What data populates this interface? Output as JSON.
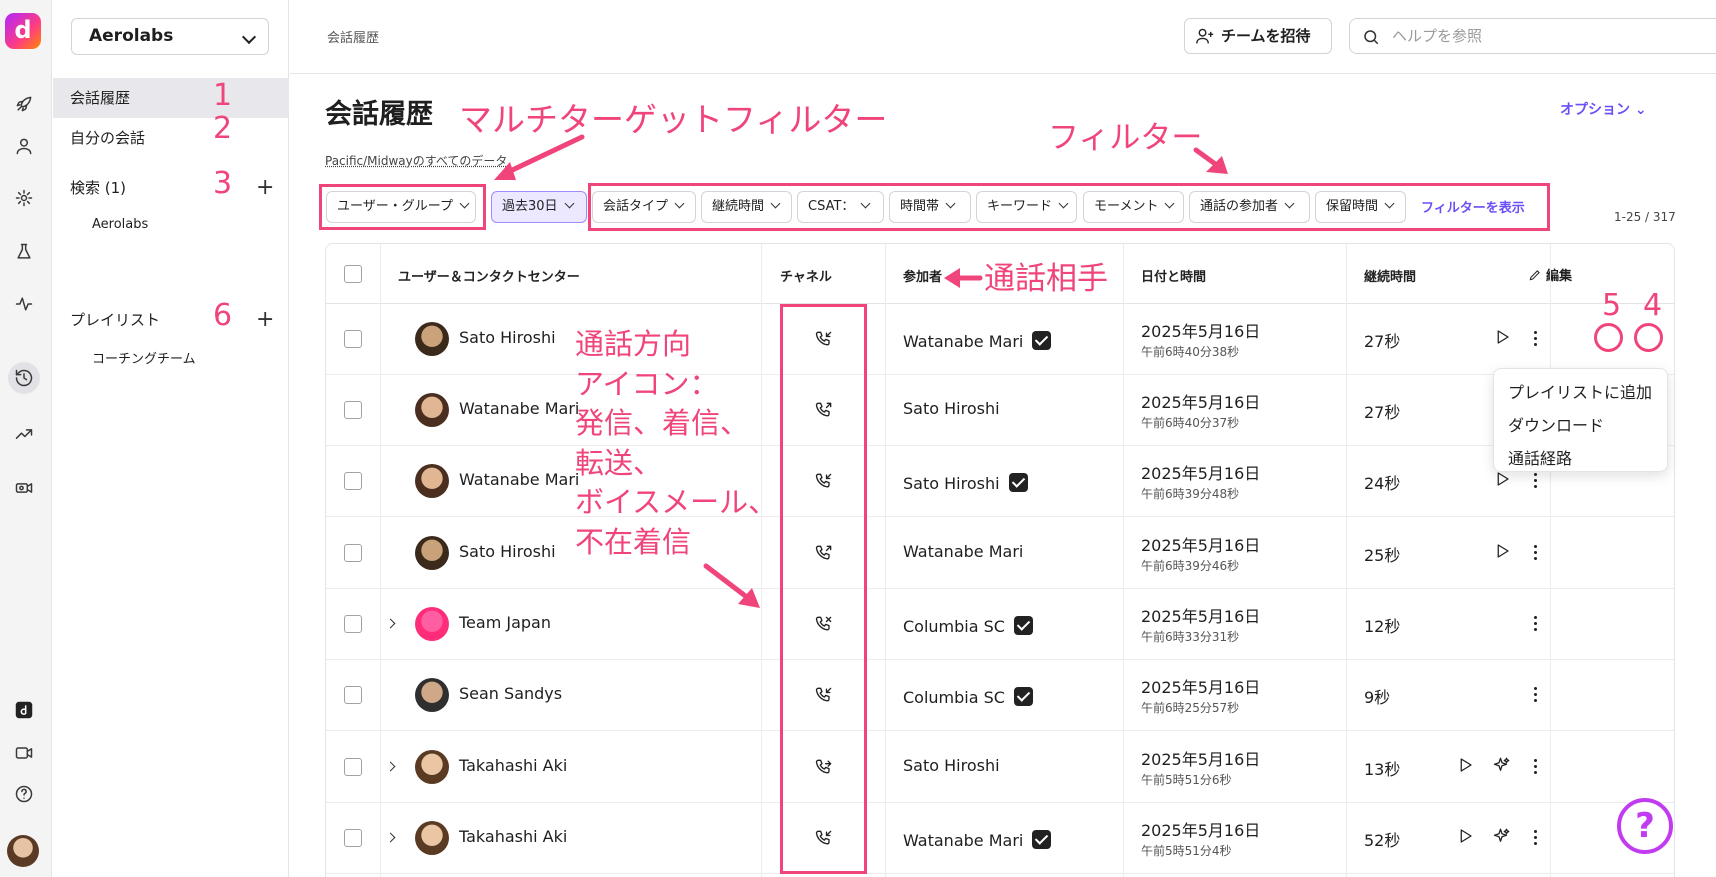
{
  "app": {
    "logo_letter": "d"
  },
  "rail": {
    "icons": [
      "rocket-icon",
      "person-icon",
      "gear-icon",
      "flask-icon",
      "pulse-icon",
      "history-icon",
      "trend-icon",
      "video-gear-icon",
      "dialpad-logo-icon",
      "camera-icon",
      "help-icon"
    ]
  },
  "sidebar": {
    "org": "Aerolabs",
    "items": [
      {
        "label": "会話履歴",
        "num": "1"
      },
      {
        "label": "自分の会話",
        "num": "2"
      },
      {
        "label": "検索 (1)",
        "num": "3"
      },
      {
        "label": "プレイリスト",
        "num": "6"
      }
    ],
    "search_sub": "Aerolabs",
    "playlist_sub": "コーチングチーム",
    "plus": "+"
  },
  "topbar": {
    "breadcrumb": "会話履歴",
    "invite_label": "チームを招待",
    "search_placeholder": "ヘルプを参照"
  },
  "main": {
    "title": "会話履歴",
    "options_label": "オプション ⌄",
    "timezone_note": "Pacific/Midwayのすべてのデータ",
    "filters": [
      "ユーザー・グループ",
      "過去30日",
      "会話タイプ",
      "継続時間",
      "CSAT：",
      "時間帯",
      "キーワード",
      "モーメント",
      "通話の参加者",
      "保留時間"
    ],
    "show_filters": "フィルターを表示",
    "count": "1-25 / 317"
  },
  "table": {
    "headers": {
      "user": "ユーザー＆コンタクトセンター",
      "channel": "チャネル",
      "participant": "参加者",
      "datetime": "日付と時間",
      "duration": "継続時間",
      "edit": "編集"
    },
    "rows": [
      {
        "user": "Sato Hiroshi",
        "participant": "Watanabe Mari",
        "verified": true,
        "date": "2025年5月16日",
        "time": "午前6時40分38秒",
        "duration": "27秒"
      },
      {
        "user": "Watanabe Mari",
        "participant": "Sato Hiroshi",
        "verified": false,
        "date": "2025年5月16日",
        "time": "午前6時40分37秒",
        "duration": "27秒"
      },
      {
        "user": "Watanabe Mari",
        "participant": "Sato Hiroshi",
        "verified": true,
        "date": "2025年5月16日",
        "time": "午前6時39分48秒",
        "duration": "24秒"
      },
      {
        "user": "Sato Hiroshi",
        "participant": "Watanabe Mari",
        "verified": false,
        "date": "2025年5月16日",
        "time": "午前6時39分46秒",
        "duration": "25秒"
      },
      {
        "user": "Team Japan",
        "participant": "Columbia SC",
        "verified": true,
        "date": "2025年5月16日",
        "time": "午前6時33分31秒",
        "duration": "12秒"
      },
      {
        "user": "Sean Sandys",
        "participant": "Columbia SC",
        "verified": true,
        "date": "2025年5月16日",
        "time": "午前6時25分57秒",
        "duration": "9秒"
      },
      {
        "user": "Takahashi Aki",
        "participant": "Sato Hiroshi",
        "verified": false,
        "date": "2025年5月16日",
        "time": "午前5時51分6秒",
        "duration": "13秒"
      },
      {
        "user": "Takahashi Aki",
        "participant": "Watanabe Mari",
        "verified": true,
        "date": "2025年5月16日",
        "time": "午前5時51分4秒",
        "duration": "52秒"
      }
    ]
  },
  "menu": {
    "items": [
      "プレイリストに追加",
      "ダウンロード",
      "通話経路"
    ]
  },
  "annotations": {
    "multi_target": "マルチターゲットフィルター",
    "filter": "フィルター",
    "counterpart": "通話相手",
    "direction": [
      "通話方向",
      "アイコン：",
      "発信、着信、",
      "転送、",
      "ボイスメール、",
      "不在着信"
    ],
    "five": "5",
    "four": "4"
  },
  "help": "?",
  "colors": {
    "accent": "#6b4ef5",
    "annotation": "#f0457a",
    "help_ring": "#c13cf0"
  }
}
